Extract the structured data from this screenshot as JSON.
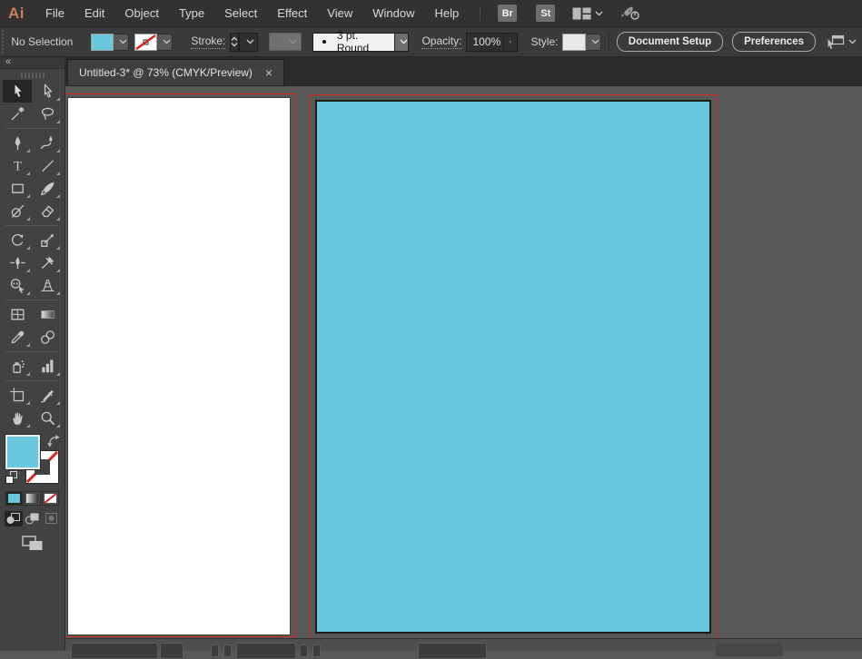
{
  "menubar": {
    "logo": "Ai",
    "menus": [
      "File",
      "Edit",
      "Object",
      "Type",
      "Select",
      "Effect",
      "View",
      "Window",
      "Help"
    ],
    "bridge_label": "Br",
    "stock_label": "St"
  },
  "control_bar": {
    "selection_status": "No Selection",
    "fill_color": "#6AC8DE",
    "stroke_swatch": "none",
    "stroke_label": "Stroke:",
    "brush_preset": "3 pt. Round",
    "opacity_label": "Opacity:",
    "opacity_value": "100%",
    "style_label": "Style:",
    "document_setup_label": "Document Setup",
    "preferences_label": "Preferences"
  },
  "document_tab": {
    "title": "Untitled-3* @ 73% (CMYK/Preview)",
    "close_glyph": "×"
  },
  "toolbar": {
    "collapse_glyph": "«",
    "selected_tool": "selection",
    "tool_groups": [
      [
        "selection",
        "direct-selection",
        "magic-wand",
        "lasso"
      ],
      [
        "pen",
        "curvature",
        "type",
        "line-segment",
        "rectangle",
        "paintbrush",
        "shaper",
        "eraser"
      ],
      [
        "rotate",
        "scale",
        "width",
        "puppet-warp",
        "shape-builder",
        "perspective-grid"
      ],
      [
        "mesh",
        "gradient",
        "eyedropper",
        "blend"
      ],
      [
        "symbol-sprayer",
        "column-graph"
      ],
      [
        "artboard",
        "slice",
        "hand",
        "zoom"
      ]
    ],
    "fill_indicator_color": "#6AC8DE",
    "stroke_indicator": "none",
    "active_color_mode": "color",
    "active_draw_mode": "draw-normal"
  },
  "canvas": {
    "artboard_left_fill": "#FFFFFF",
    "artboard_right_fill": "#6AC8DE",
    "selection_outline_color": "#D9281C"
  },
  "colors": {
    "accent_blue": "#6AC8DE",
    "selection_red": "#D9281C",
    "panel_gray": "#424242",
    "canvas_gray": "#575757"
  }
}
